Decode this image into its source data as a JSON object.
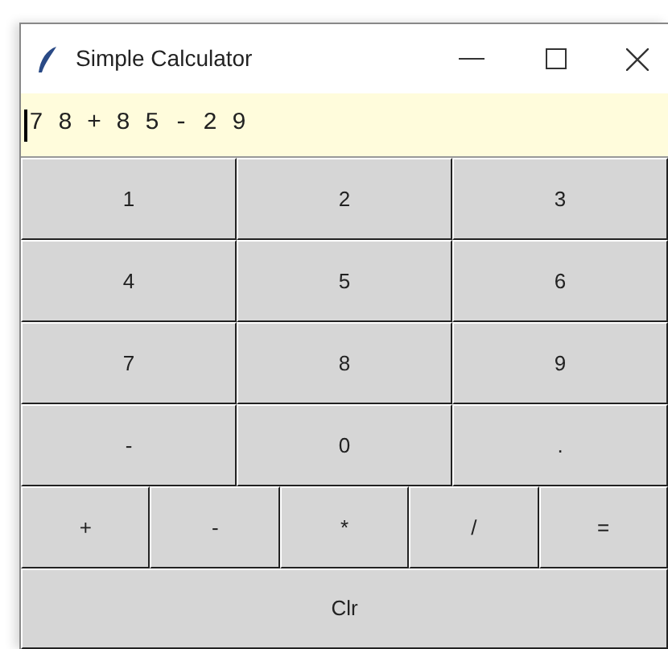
{
  "window": {
    "title": "Simple Calculator"
  },
  "display": {
    "value": "7 8 + 8 5 - 2 9"
  },
  "digit_rows": [
    [
      "1",
      "2",
      "3"
    ],
    [
      "4",
      "5",
      "6"
    ],
    [
      "7",
      "8",
      "9"
    ],
    [
      "-",
      "0",
      "."
    ]
  ],
  "operator_row": [
    "+",
    "-",
    "*",
    "/",
    "="
  ],
  "clear_button": "Clr"
}
